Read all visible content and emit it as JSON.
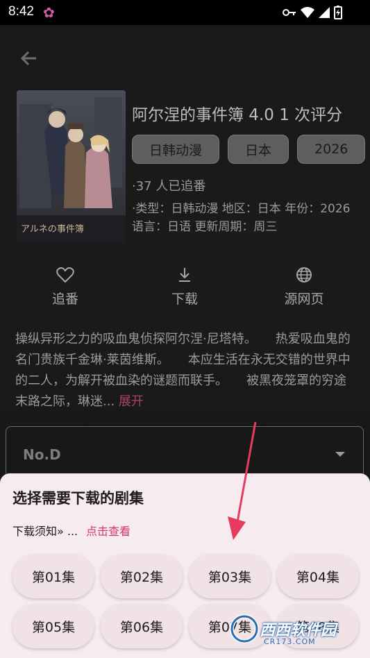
{
  "status_bar": {
    "time": "8:42"
  },
  "show": {
    "title": "阿尔涅的事件簿 4.0 1 次评分",
    "tags": [
      "日韩动漫",
      "日本",
      "2026"
    ],
    "followers": "·37 人已追番",
    "meta": "·类型：日韩动漫 地区：日本 年份：2026 语言：日语 更新周期：周三",
    "poster_logo": "アルネの事件簿"
  },
  "actions": [
    {
      "label": "追番",
      "icon": "heart-icon"
    },
    {
      "label": "下载",
      "icon": "download-icon"
    },
    {
      "label": "源网页",
      "icon": "globe-icon"
    }
  ],
  "description": {
    "text": "操纵异形之力的吸血鬼侦探阿尔涅·尼塔特。　　热爱吸血鬼的名门贵族千金琳·莱茵维斯。　　本应生活在永无交错的世界中的二人，为解开被血染的谜题而联手。　　被黑夜笼罩的穷途末路之际，琳迷...",
    "expand_label": "展开"
  },
  "source": {
    "selected": "No.D"
  },
  "download_sheet": {
    "title": "选择需要下载的剧集",
    "notice_label": "下载须知» ...",
    "notice_link": "点击查看",
    "episodes": [
      "第01集",
      "第02集",
      "第03集",
      "第04集",
      "第05集",
      "第06集",
      "第07集",
      "第08集"
    ]
  },
  "watermark": {
    "text": "西西软件园",
    "sub": "CR173.COM"
  },
  "colors": {
    "accent": "#d2386a",
    "sheet_bg": "#f6ecef",
    "page_bg": "#1a1a1a"
  }
}
